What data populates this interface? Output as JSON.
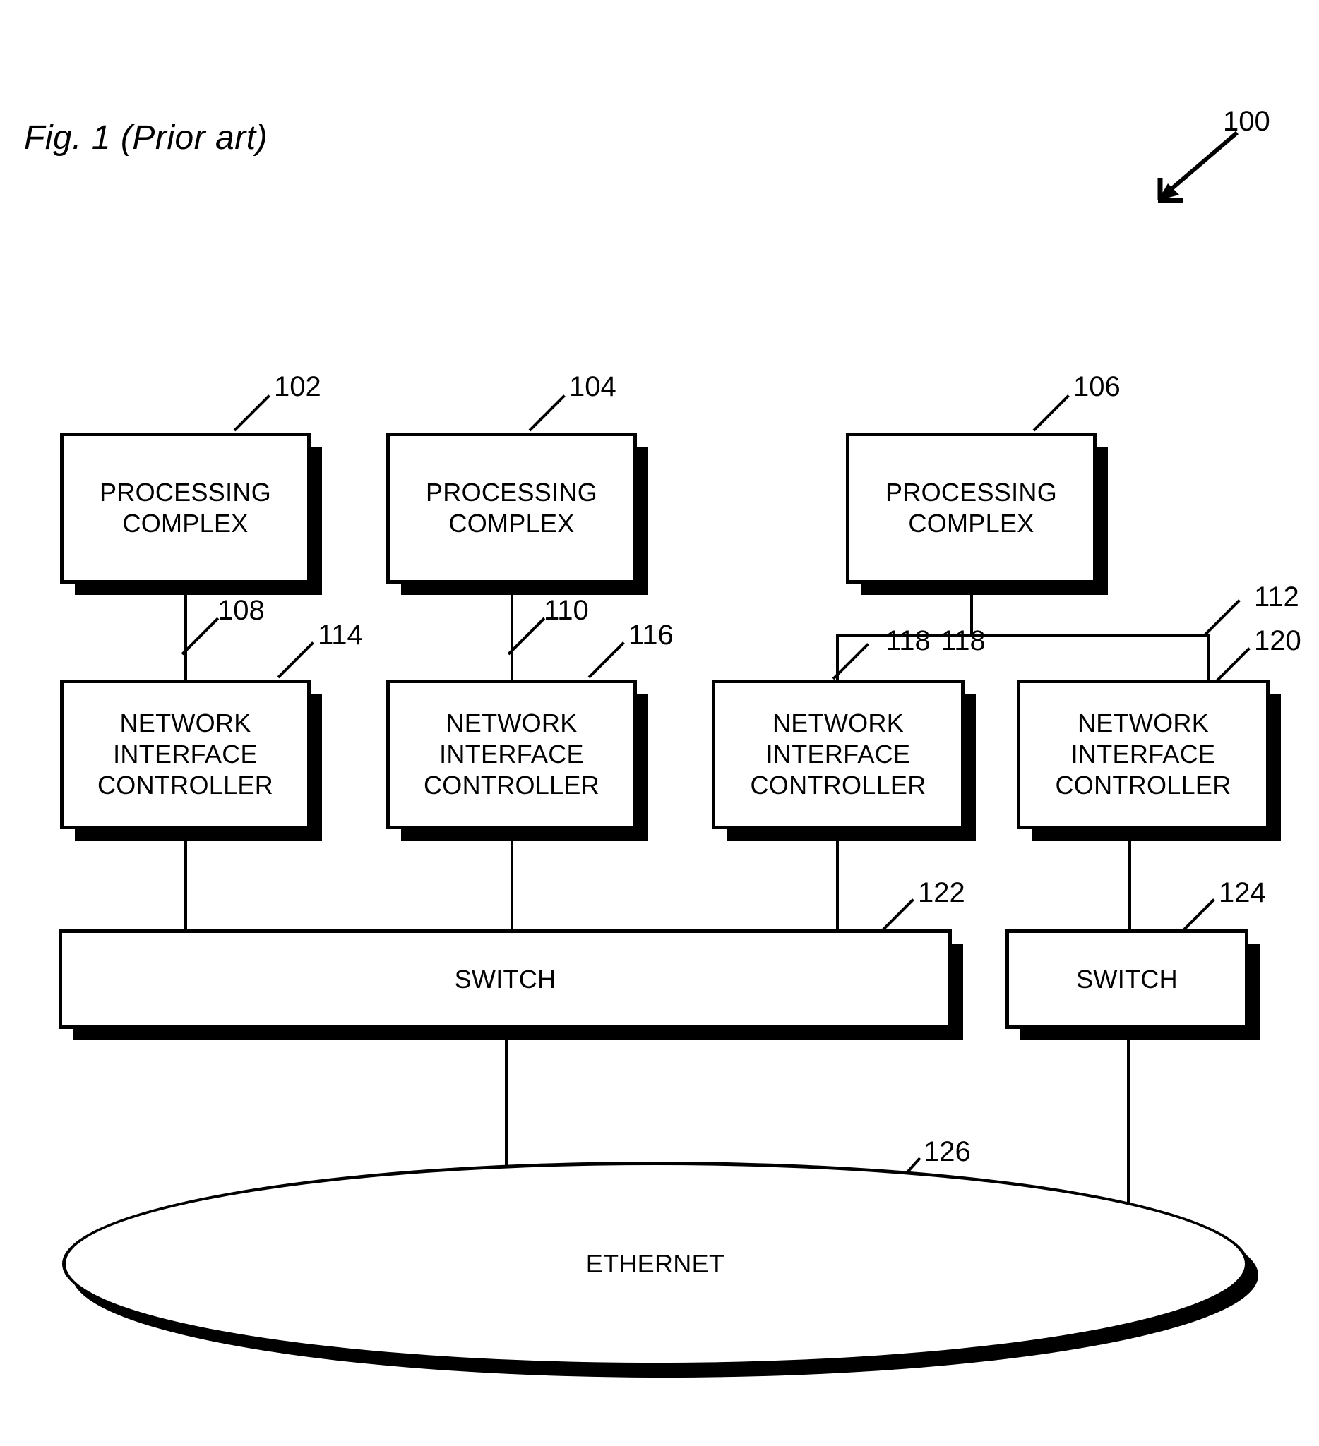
{
  "figure": {
    "title": "Fig. 1 (Prior art)",
    "system_ref": "100"
  },
  "processing_complexes": [
    {
      "label": "PROCESSING\nCOMPLEX",
      "ref": "102"
    },
    {
      "label": "PROCESSING\nCOMPLEX",
      "ref": "104"
    },
    {
      "label": "PROCESSING\nCOMPLEX",
      "ref": "106"
    }
  ],
  "network_interface_controllers": [
    {
      "label": "NETWORK\nINTERFACE\nCONTROLLER",
      "ref": "114"
    },
    {
      "label": "NETWORK\nINTERFACE\nCONTROLLER",
      "ref": "116"
    },
    {
      "label": "NETWORK\nINTERFACE\nCONTROLLER",
      "ref": "118"
    },
    {
      "label": "NETWORK\nINTERFACE\nCONTROLLER",
      "ref": "120"
    }
  ],
  "switches": [
    {
      "label": "SWITCH",
      "ref": "122"
    },
    {
      "label": "SWITCH",
      "ref": "124"
    }
  ],
  "network": {
    "label": "ETHERNET",
    "ref": "126"
  },
  "links": [
    {
      "ref": "108",
      "from": "102",
      "to": "114"
    },
    {
      "ref": "110",
      "from": "104",
      "to": "116"
    },
    {
      "ref": "118",
      "from": "106",
      "to": "118"
    },
    {
      "ref": "112",
      "from": "106",
      "to": "120"
    }
  ],
  "colors": {
    "stroke": "#000000",
    "fill": "#ffffff",
    "shadow": "#000000"
  }
}
